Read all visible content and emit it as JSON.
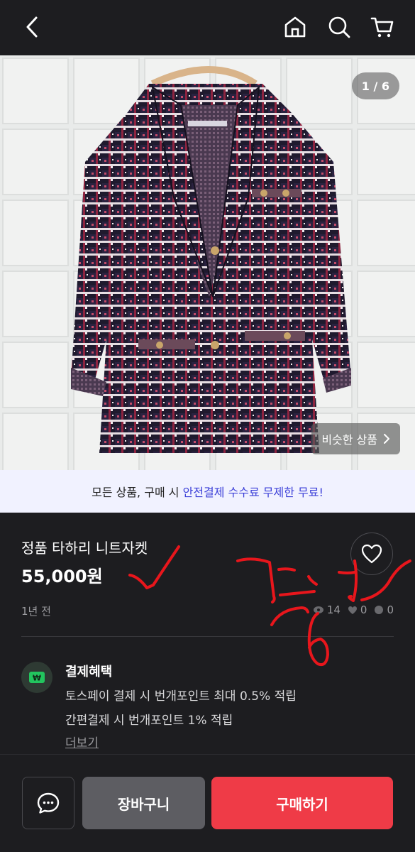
{
  "header": {
    "back_icon": "chevron-left-icon",
    "home_icon": "home-icon",
    "search_icon": "search-icon",
    "cart_icon": "cart-icon"
  },
  "photo": {
    "page_indicator": "1 / 6",
    "similar_button": "비슷한 상품",
    "similar_icon": "chevron-right-icon"
  },
  "promo": {
    "prefix": "모든 상품, 구매 시 ",
    "highlight": "안전결제 수수료 무제한 무료!"
  },
  "product": {
    "title": "정품 타하리 니트자켓",
    "price": "55,000원",
    "posted": "1년 전",
    "views": "14",
    "likes": "0",
    "chats": "0"
  },
  "benefit": {
    "title": "결제혜택",
    "line1": "토스페이 결제 시 번개포인트 최대 0.5% 적립",
    "line2": "간편결제 시 번개포인트 1% 적립",
    "more": "더보기",
    "icon_label": "₩"
  },
  "bottom": {
    "chat_icon": "chat-icon",
    "cart_label": "장바구니",
    "buy_label": "구매하기"
  },
  "colors": {
    "background": "#1d1d20",
    "accent_red": "#ef3b47",
    "promo_highlight": "#3b3fd8",
    "scribble": "#e8161c"
  }
}
